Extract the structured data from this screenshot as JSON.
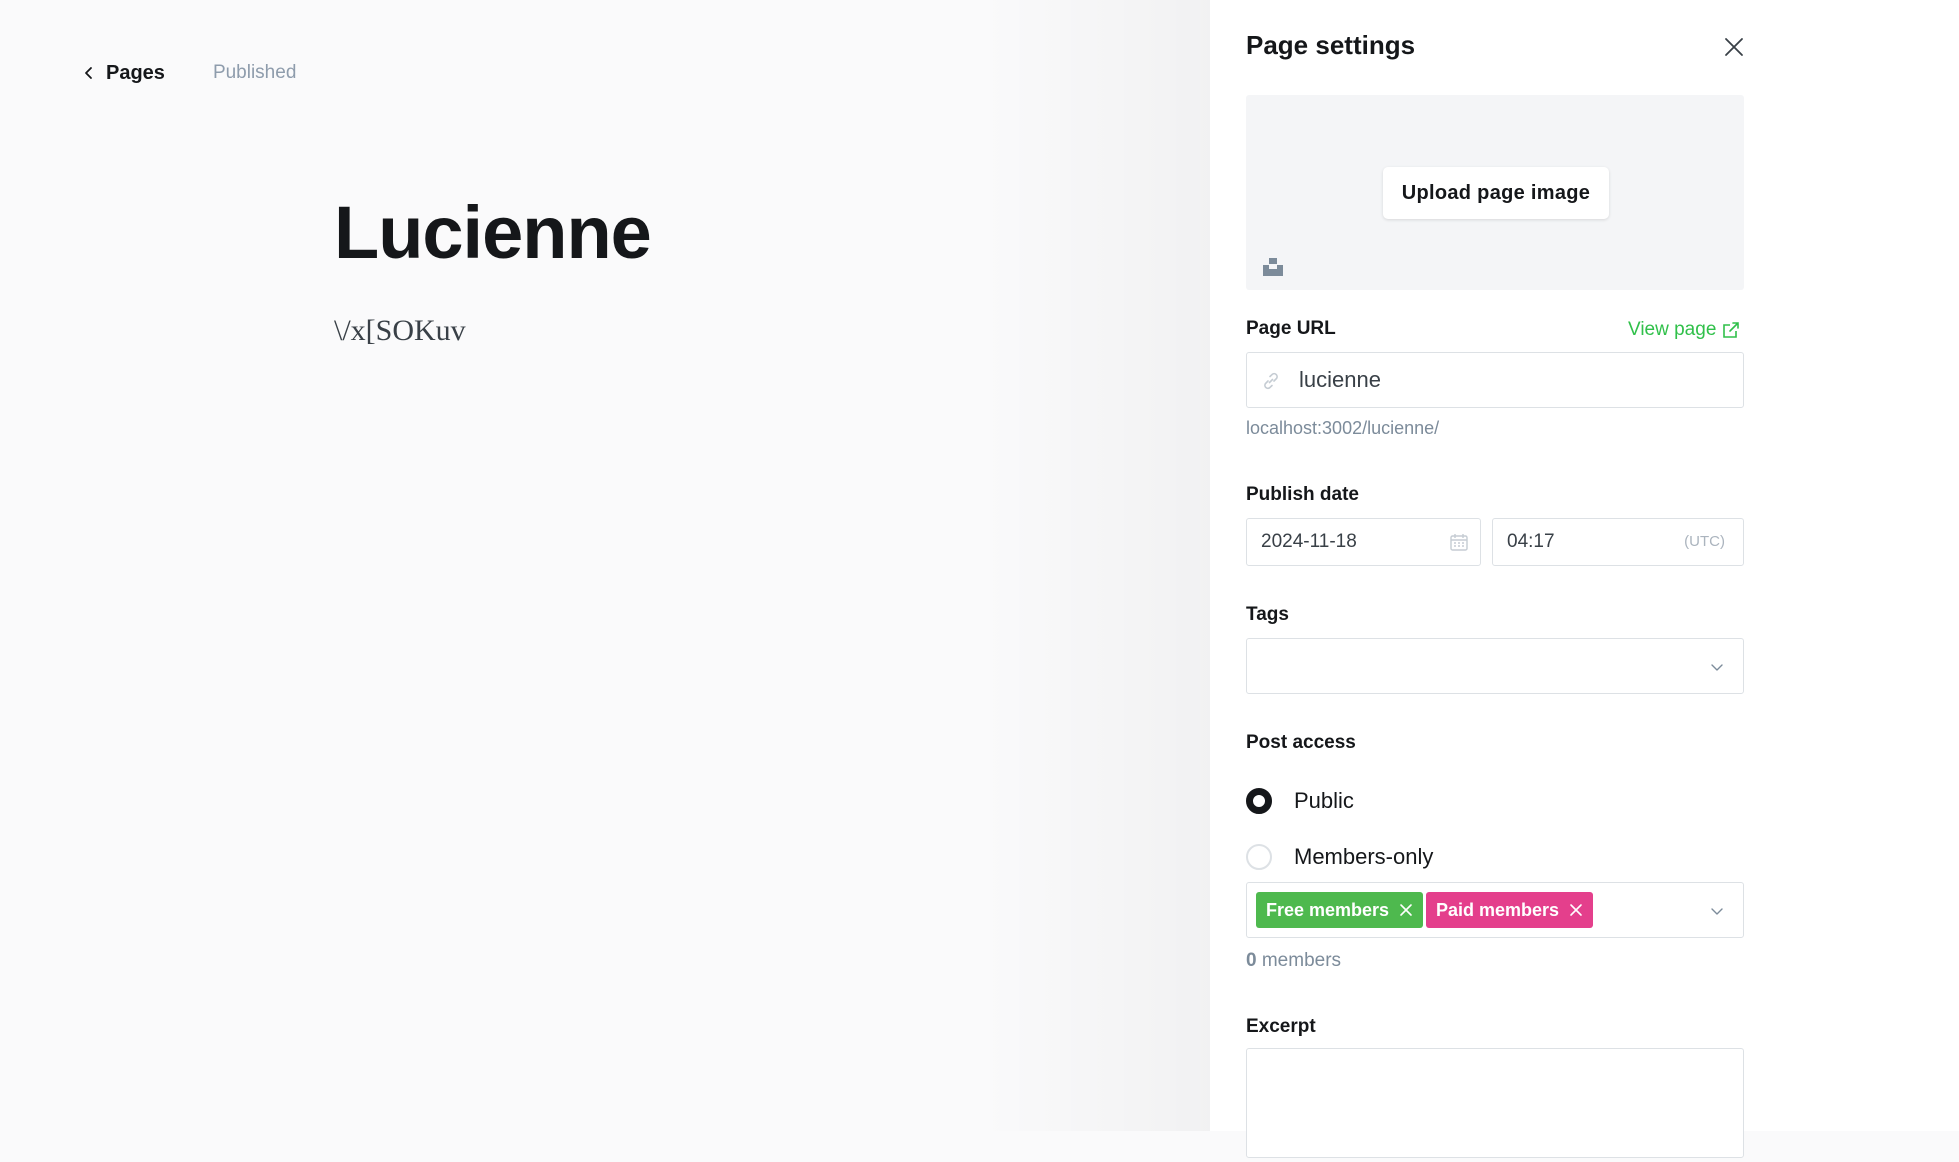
{
  "editor": {
    "back_label": "Pages",
    "status": "Published",
    "title": "Lucienne",
    "body": "\\/x[SOKuv"
  },
  "panel": {
    "title": "Page settings",
    "upload_label": "Upload page image",
    "url": {
      "label": "Page URL",
      "view_label": "View page",
      "value": "lucienne",
      "hint": "localhost:3002/lucienne/"
    },
    "publish": {
      "label": "Publish date",
      "date": "2024-11-18",
      "time": "04:17",
      "timezone": "(UTC)"
    },
    "tags": {
      "label": "Tags"
    },
    "access": {
      "label": "Post access",
      "options": [
        {
          "label": "Public",
          "checked": true
        },
        {
          "label": "Members-only",
          "checked": false
        }
      ],
      "segments": [
        "Free members",
        "Paid members"
      ],
      "member_count": "0",
      "member_suffix": "members"
    },
    "excerpt": {
      "label": "Excerpt"
    }
  },
  "colors": {
    "accent_green": "#30c04a",
    "free_token": "#4eb94e",
    "paid_token": "#e43f8c"
  }
}
